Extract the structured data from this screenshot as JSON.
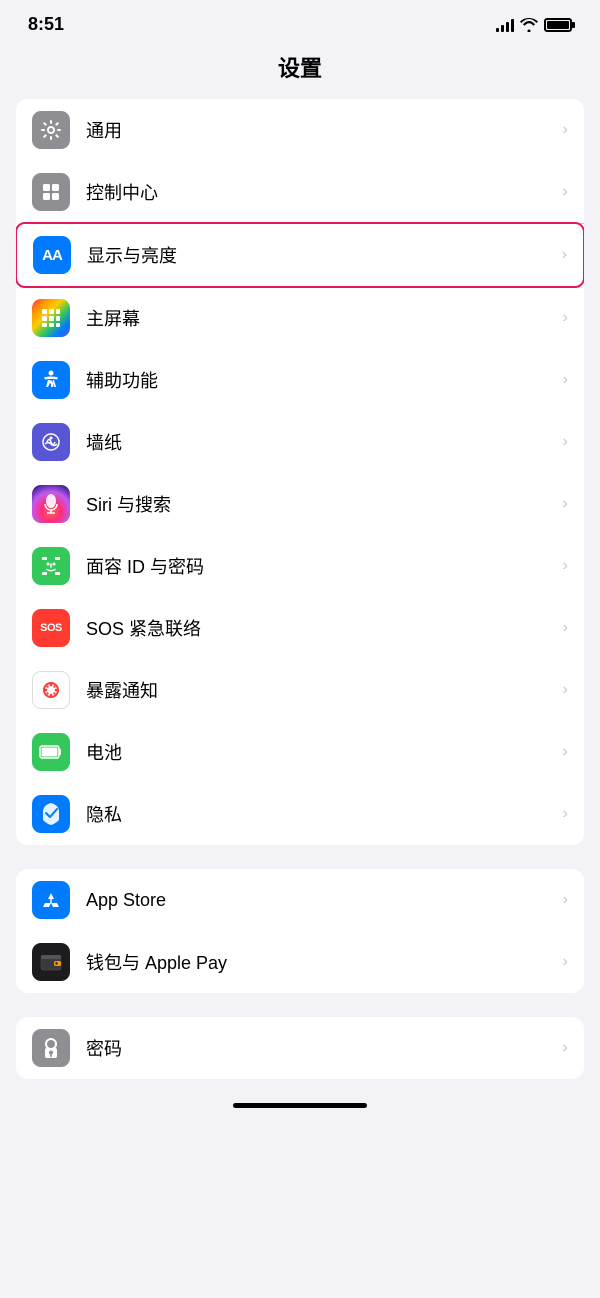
{
  "statusBar": {
    "time": "8:51",
    "battery": "full"
  },
  "pageTitle": "设置",
  "group1": {
    "items": [
      {
        "id": "general",
        "label": "通用",
        "iconType": "gear",
        "iconBg": "gray",
        "highlighted": false
      },
      {
        "id": "control-center",
        "label": "控制中心",
        "iconType": "toggle",
        "iconBg": "gray",
        "highlighted": false
      },
      {
        "id": "display",
        "label": "显示与亮度",
        "iconType": "aa",
        "iconBg": "blue",
        "highlighted": true
      },
      {
        "id": "home-screen",
        "label": "主屏幕",
        "iconType": "grid",
        "iconBg": "colorful",
        "highlighted": false
      },
      {
        "id": "accessibility",
        "label": "辅助功能",
        "iconType": "person",
        "iconBg": "teal",
        "highlighted": false
      },
      {
        "id": "wallpaper",
        "label": "墙纸",
        "iconType": "flower",
        "iconBg": "flower",
        "highlighted": false
      },
      {
        "id": "siri",
        "label": "Siri 与搜索",
        "iconType": "siri",
        "iconBg": "siri",
        "highlighted": false
      },
      {
        "id": "faceid",
        "label": "面容 ID 与密码",
        "iconType": "faceid",
        "iconBg": "green",
        "highlighted": false
      },
      {
        "id": "sos",
        "label": "SOS 紧急联络",
        "iconType": "sos",
        "iconBg": "red",
        "highlighted": false
      },
      {
        "id": "exposure",
        "label": "暴露通知",
        "iconType": "exposure",
        "iconBg": "exposure",
        "highlighted": false
      },
      {
        "id": "battery",
        "label": "电池",
        "iconType": "battery",
        "iconBg": "battery",
        "highlighted": false
      },
      {
        "id": "privacy",
        "label": "隐私",
        "iconType": "hand",
        "iconBg": "privacy",
        "highlighted": false
      }
    ]
  },
  "group2": {
    "items": [
      {
        "id": "appstore",
        "label": "App Store",
        "iconType": "appstore",
        "iconBg": "appstore",
        "highlighted": false
      },
      {
        "id": "wallet",
        "label": "钱包与 Apple Pay",
        "iconType": "wallet",
        "iconBg": "wallet",
        "highlighted": false
      }
    ]
  },
  "group3": {
    "items": [
      {
        "id": "password",
        "label": "密码",
        "iconType": "key",
        "iconBg": "password",
        "highlighted": false
      }
    ]
  }
}
